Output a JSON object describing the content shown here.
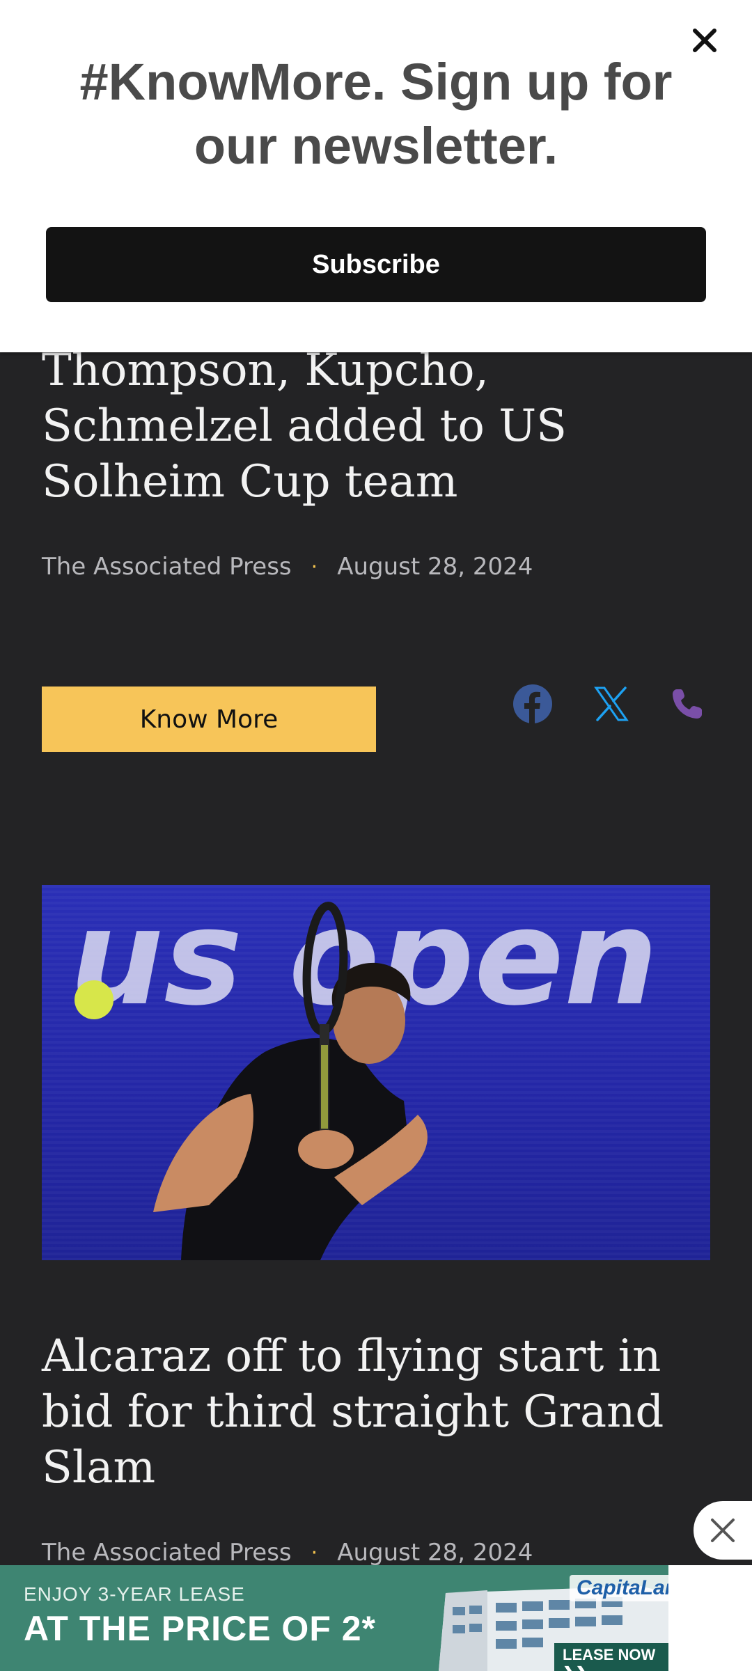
{
  "newsletter": {
    "headline": "#KnowMore. Sign up for our newsletter.",
    "subscribe_label": "Subscribe",
    "close_icon": "close-icon"
  },
  "articles": [
    {
      "title": "Thompson, Kupcho, Schmelzel added to US Solheim Cup team",
      "source": "The Associated Press",
      "separator": "·",
      "date": "August 28, 2024",
      "know_more_label": "Know More"
    },
    {
      "title": "Alcaraz off to flying start in bid for third straight Grand Slam",
      "source": "The Associated Press",
      "separator": "·",
      "date": "August 28, 2024",
      "image_text": "us open"
    }
  ],
  "share": {
    "icons": [
      "facebook-icon",
      "x-icon",
      "phone-icon"
    ],
    "colors": {
      "facebook": "#3b5998",
      "x": "#1da1f2",
      "phone": "#7a4fa8"
    }
  },
  "ad": {
    "small_text": "ENJOY 3-YEAR LEASE",
    "big_text": "AT THE PRICE OF 2*",
    "brand": "CapitaLand",
    "cta": "LEASE NOW ❯❯"
  },
  "colors": {
    "background": "#232325",
    "accent": "#f7c559",
    "ad_green": "#3e8572"
  }
}
